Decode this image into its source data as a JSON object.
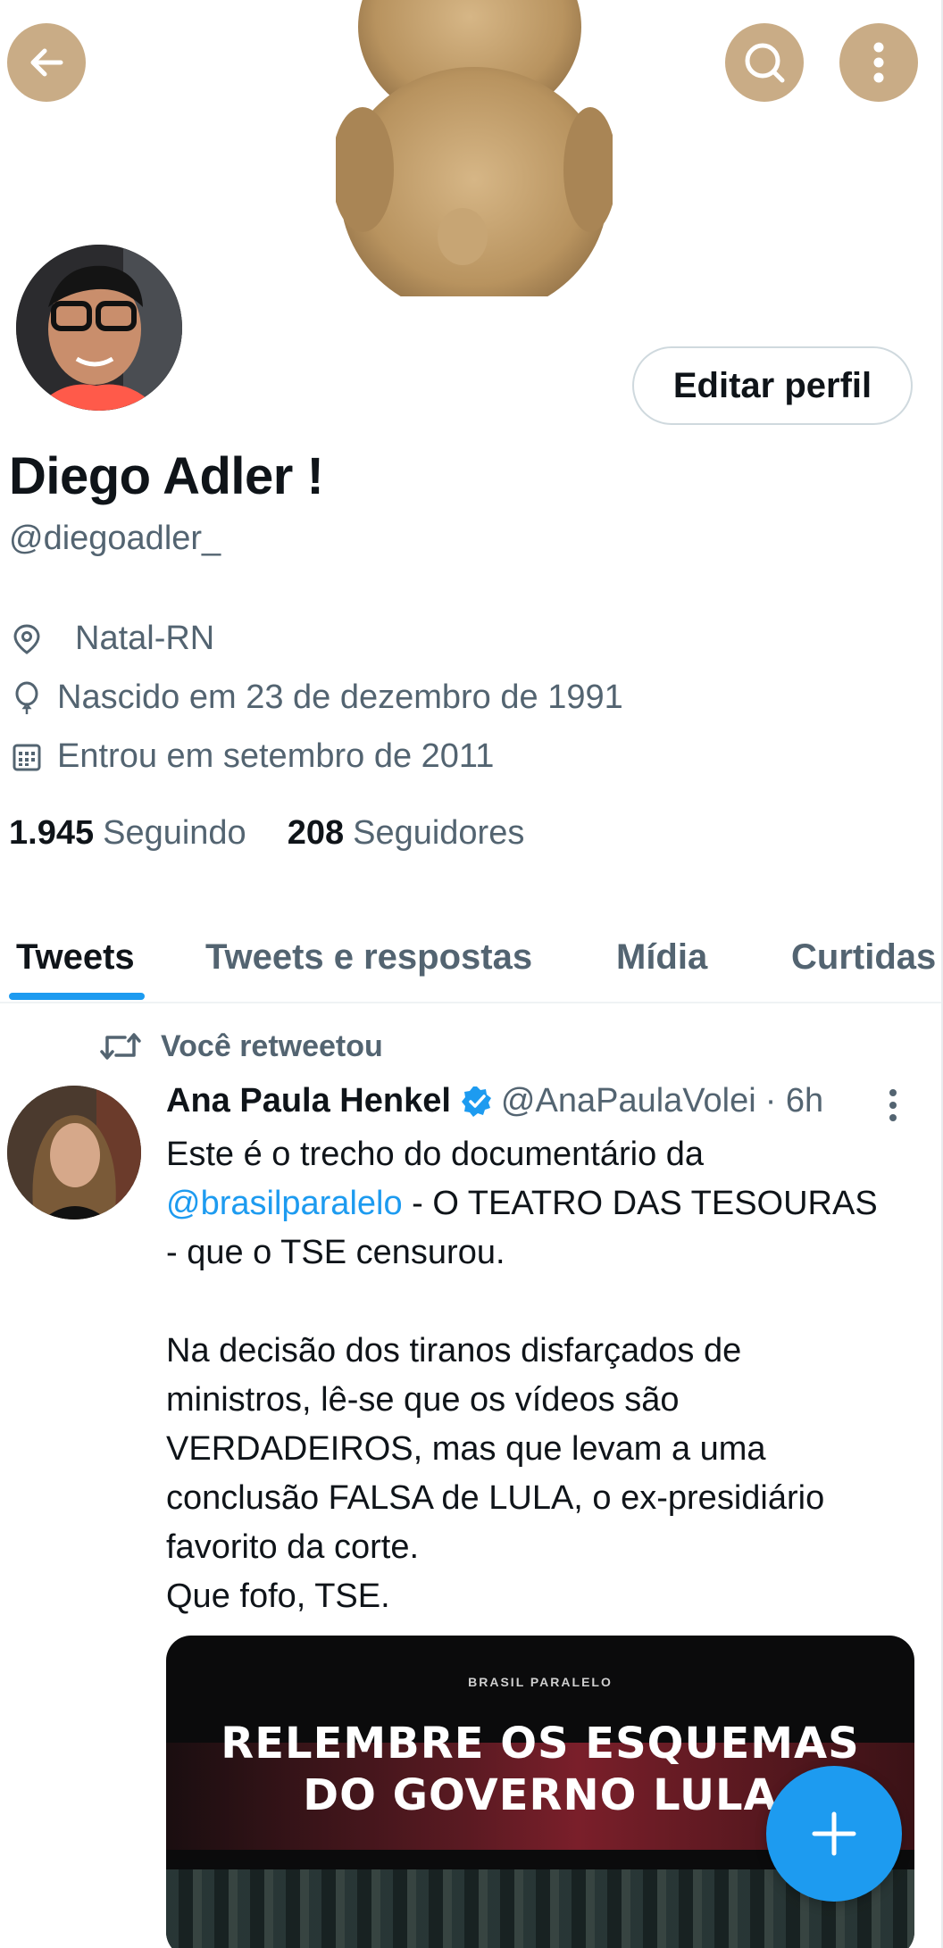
{
  "header": {
    "back_icon": "arrow-left-icon",
    "search_icon": "search-icon",
    "more_icon": "more-vertical-icon",
    "button_color": "#c9ac86"
  },
  "profile": {
    "edit_label": "Editar perfil",
    "name": "Diego Adler !",
    "handle": "@diegoadler_",
    "location": "Natal-RN",
    "birthday": "Nascido em 23 de dezembro de 1991",
    "joined": "Entrou em setembro de 2011",
    "following_count": "1.945",
    "following_label": "Seguindo",
    "followers_count": "208",
    "followers_label": "Seguidores"
  },
  "tabs": [
    {
      "label": "Tweets",
      "active": true
    },
    {
      "label": "Tweets e respostas",
      "active": false
    },
    {
      "label": "Mídia",
      "active": false
    },
    {
      "label": "Curtidas",
      "active": false
    }
  ],
  "tweet": {
    "retweet_label": "Você retweetou",
    "author": "Ana Paula Henkel",
    "handle": "@AnaPaulaVolei",
    "time": "· 6h",
    "body_line1_pre": "Este é o trecho do documentário da",
    "mention": "@brasilparalelo",
    "body_line2_post": " - O TEATRO DAS TESOURAS",
    "body_line3": "- que o TSE censurou.",
    "para2": "Na decisão dos tiranos disfarçados de ministros, lê-se que os vídeos são VERDADEIROS, mas que levam a uma conclusão FALSA de LULA, o ex-presidiário favorito da corte.",
    "para3": "Que fofo, TSE.",
    "media_brand": "BRASIL PARALELO",
    "media_headline_1": "RELEMBRE OS ESQUEMAS",
    "media_headline_2": "DO GOVERNO LULA"
  },
  "colors": {
    "accent": "#1d9bf0",
    "secondary_text": "#536471",
    "primary_text": "#0f1419"
  }
}
